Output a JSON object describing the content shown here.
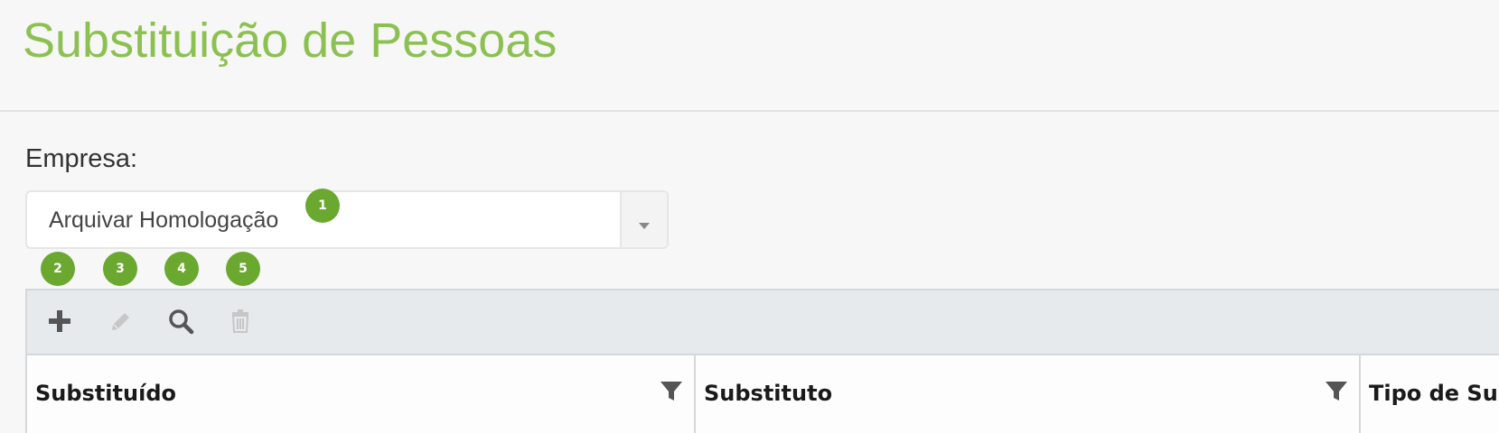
{
  "header": {
    "title": "Substituição de Pessoas"
  },
  "form": {
    "empresa_label": "Empresa:",
    "empresa_value": "Arquivar Homologação"
  },
  "badges": [
    "1",
    "2",
    "3",
    "4",
    "5"
  ],
  "toolbar": {
    "tools": [
      {
        "icon": "plus-icon",
        "enabled": true
      },
      {
        "icon": "pencil-icon",
        "enabled": false
      },
      {
        "icon": "search-icon",
        "enabled": true
      },
      {
        "icon": "trash-icon",
        "enabled": false
      }
    ]
  },
  "grid": {
    "columns": [
      {
        "label": "Substituído",
        "filter_icon": "filter-icon"
      },
      {
        "label": "Substituto",
        "filter_icon": "filter-icon"
      },
      {
        "label": "Tipo de Su"
      }
    ]
  },
  "colors": {
    "title": "#8cc152",
    "badge": "#6aa82f",
    "toolbar_bg": "#e7eaed"
  }
}
